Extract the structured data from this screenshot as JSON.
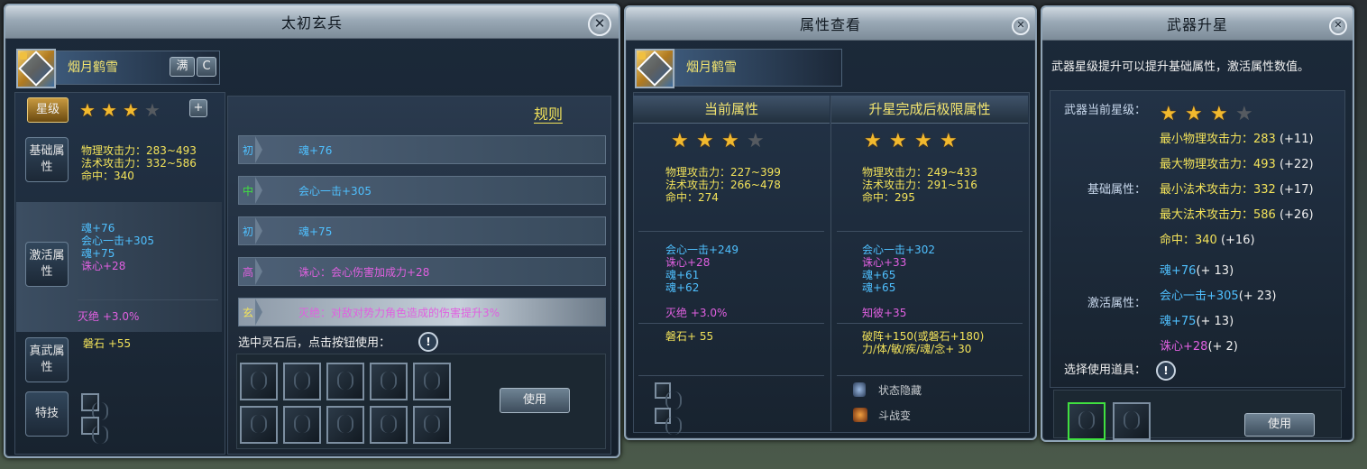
{
  "win1": {
    "title": "太初玄兵",
    "close": "✕",
    "item_name": "烟月鹤雪",
    "full_btn": "满",
    "refresh_btn": "C",
    "star_tab": "星级",
    "stars": {
      "filled": 3,
      "total": 4
    },
    "plus": "+",
    "tabs": {
      "base": "基础属性",
      "active": "激活属性",
      "true": "真武属性",
      "skill": "特技"
    },
    "base_stats": [
      "物理攻击力：283~493",
      "法术攻击力：332~586",
      "命中：340"
    ],
    "active_stats": [
      "魂+76",
      "会心一击+305",
      "魂+75",
      "诛心+28"
    ],
    "active_extra": "灭绝 +3.0%",
    "true_stat": "磐石 +55",
    "rules": {
      "title": "规则",
      "rows": [
        {
          "tag": "初",
          "text": "魂+76"
        },
        {
          "tag": "中",
          "text": "会心一击+305"
        },
        {
          "tag": "初",
          "text": "魂+75"
        },
        {
          "tag": "高",
          "text": "诛心：会心伤害加成力+28"
        },
        {
          "tag": "玄",
          "text": "灭绝：对敌对势力角色造成的伤害提升3%"
        }
      ],
      "select_hint": "选中灵石后，点击按钮使用：",
      "use_btn": "使用"
    }
  },
  "win2": {
    "title": "属性查看",
    "close": "✕",
    "item_name": "烟月鹤雪",
    "col_current": "当前属性",
    "col_after": "升星完成后极限属性",
    "current_stars": {
      "filled": 3,
      "total": 4
    },
    "after_stars": {
      "filled": 4,
      "total": 4
    },
    "current_base": [
      "物理攻击力：227~399",
      "法术攻击力：266~478",
      "命中：274"
    ],
    "after_base": [
      "物理攻击力：249~433",
      "法术攻击力：291~516",
      "命中：295"
    ],
    "current_active": [
      "会心一击+249",
      "诛心+28",
      "魂+61",
      "魂+62"
    ],
    "after_active": [
      "会心一击+302",
      "诛心+33",
      "魂+65",
      "魂+65"
    ],
    "current_extra": "灭绝 +3.0%",
    "after_extra": "知彼+35",
    "current_true": "磐石+ 55",
    "after_true": [
      "破阵+150(或磐石+180)",
      "力/体/敏/疾/魂/念+ 30"
    ],
    "skills": [
      "状态隐藏",
      "斗战变"
    ]
  },
  "win3": {
    "title": "武器升星",
    "close": "✕",
    "desc": "武器星级提升可以提升基础属性，激活属性数值。",
    "star_label": "武器当前星级：",
    "stars": {
      "filled": 3,
      "total": 4
    },
    "base_label": "基础属性：",
    "base_stats": [
      {
        "name": "最小物理攻击力：",
        "value": "283",
        "delta": "(+11)"
      },
      {
        "name": "最大物理攻击力：",
        "value": "493",
        "delta": "(+22)"
      },
      {
        "name": "最小法术攻击力：",
        "value": "332",
        "delta": "(+17)"
      },
      {
        "name": "最大法术攻击力：",
        "value": "586",
        "delta": "(+26)"
      },
      {
        "name": "命中：",
        "value": "340",
        "delta": "(+16)"
      }
    ],
    "active_label": "激活属性：",
    "active_stats": [
      {
        "name": "魂+76",
        "delta": "(+ 13)"
      },
      {
        "name": "会心一击+305",
        "delta": "(+ 23)"
      },
      {
        "name": "魂+75",
        "delta": "(+ 13)"
      },
      {
        "name": "诛心+28",
        "delta": "(+ 2)"
      }
    ],
    "select_label": "选择使用道具：",
    "use_btn": "使用"
  },
  "colors": {
    "accent_yellow": "#f3e35a",
    "accent_blue": "#4fc0ff",
    "accent_pink": "#e060e0"
  }
}
